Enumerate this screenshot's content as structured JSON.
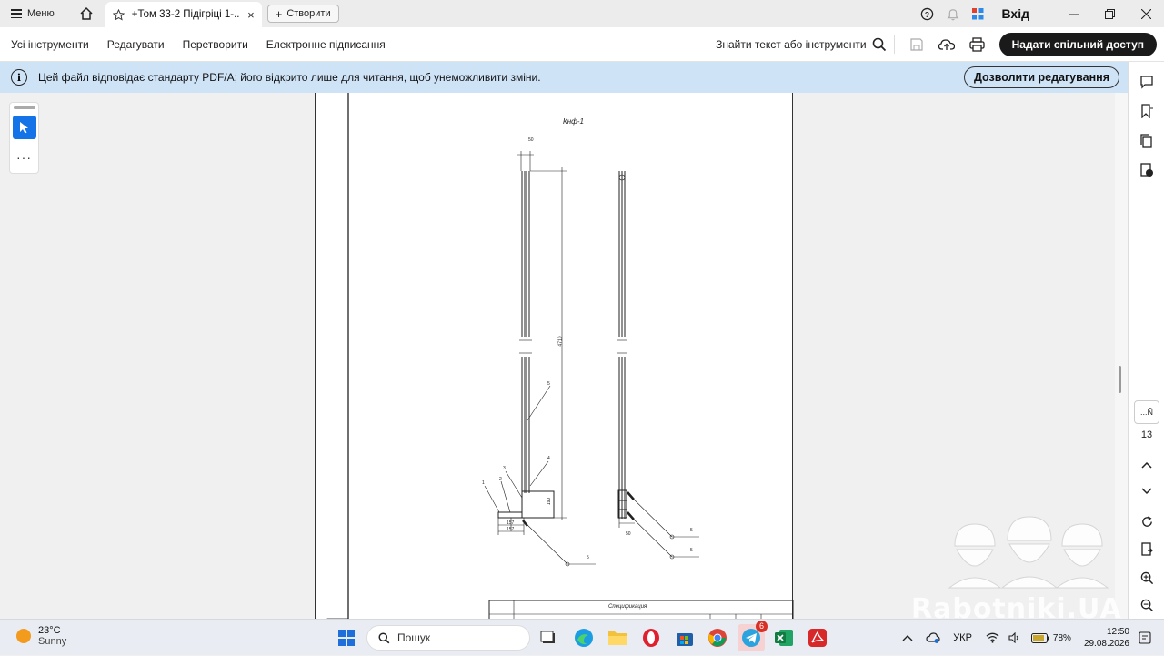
{
  "titlebar": {
    "menu_label": "Меню",
    "tab_title": "+Том 33-2 Підігріці 1-...",
    "tab_close": "×",
    "new_label": "Створити",
    "login_label": "Вхід"
  },
  "toolbar": {
    "items": [
      "Усі інструменти",
      "Редагувати",
      "Перетворити",
      "Електронне підписання"
    ],
    "find_label": "Знайти текст або інструменти",
    "share_label": "Надати спільний доступ"
  },
  "banner": {
    "message": "Цей файл відповідає стандарту PDF/A; його відкрито лише для читання, щоб унеможливити зміни.",
    "allow_label": "Дозволити редагування"
  },
  "left_tools": {
    "more": "···"
  },
  "right_rail": {
    "page_widget": "...Ñ",
    "page_number": "13"
  },
  "drawing": {
    "title": "Кнф-1",
    "spec_title": "Спецификация",
    "labels": {
      "dim_top_left": "50",
      "dim_height": "4710",
      "dim_small": "190",
      "dim_base1": "157",
      "dim_base2": "157",
      "dim_right_bottom": "50",
      "callout_1": "1",
      "callout_2": "2",
      "callout_3": "3",
      "callout_4": "4",
      "callout_5a": "5",
      "callout_5b": "5",
      "callout_5c": "5",
      "callout_5d": "5"
    }
  },
  "watermark": {
    "text": "Rabotniki.UA"
  },
  "taskbar": {
    "temperature": "23°C",
    "condition": "Sunny",
    "search_placeholder": "Пошук",
    "telegram_badge": "6",
    "language": "УКР",
    "battery": "78%",
    "time": "12:50",
    "date": "29.08.2026"
  }
}
